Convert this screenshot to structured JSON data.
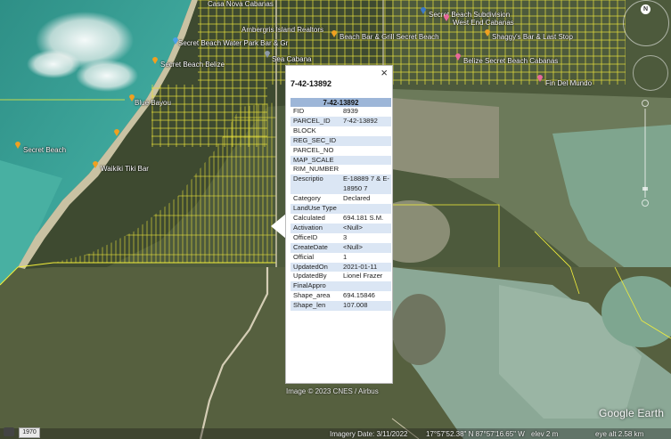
{
  "colors": {
    "parcel_lines": "#f4f03a",
    "popup_header": "#9db6d8",
    "popup_alt_row": "#dbe6f4",
    "pin_orange": "#f0a020",
    "pin_pink": "#e8689a"
  },
  "map_labels": [
    {
      "name": "Casa Nova Cabanas",
      "icon": "orange-pin-icon"
    },
    {
      "name": "Ambergris Island Realtors",
      "icon": "orange-pin-icon"
    },
    {
      "name": "Secret Beach Subdivision",
      "icon": "blue-pin-icon"
    },
    {
      "name": "West End Cabanas",
      "icon": "pink-pin-icon"
    },
    {
      "name": "Secret Beach Water Park Bar & Gr",
      "icon": "blue-pin-icon"
    },
    {
      "name": "Beach Bar & Grill Secret Beach",
      "icon": "orange-pin-icon"
    },
    {
      "name": "Shaggy's Bar & Last Stop",
      "icon": "orange-pin-icon"
    },
    {
      "name": "Sea Cabana",
      "icon": "gray-pin-icon"
    },
    {
      "name": "Secret Beach Belize",
      "icon": "orange-pin-icon"
    },
    {
      "name": "Belize Secret Beach Cabanas",
      "icon": "pink-pin-icon"
    },
    {
      "name": "Fin Del Mundo",
      "icon": "pink-pin-icon"
    },
    {
      "name": "Blue Bayou",
      "icon": "orange-pin-icon"
    },
    {
      "name": "Secret Beach",
      "icon": "orange-pin-icon"
    },
    {
      "name": "Waikiki Tiki Bar",
      "icon": "orange-pin-icon"
    }
  ],
  "popup": {
    "close_label": "×",
    "title": "7-42-13892",
    "table_header": "7-42-13892",
    "rows": [
      {
        "key": "FID",
        "value": "8939"
      },
      {
        "key": "PARCEL_ID",
        "value": "7-42-13892"
      },
      {
        "key": "BLOCK",
        "value": ""
      },
      {
        "key": "REG_SEC_ID",
        "value": ""
      },
      {
        "key": "PARCEL_NO",
        "value": ""
      },
      {
        "key": "MAP_SCALE",
        "value": ""
      },
      {
        "key": "RIM_NUMBER",
        "value": ""
      },
      {
        "key": "Descriptio",
        "value": "E-18889 7 & E-18950 7"
      },
      {
        "key": "Category",
        "value": "Declared"
      },
      {
        "key": "LandUse Type",
        "value": ""
      },
      {
        "key": "Calculated",
        "value": "694.181 S.M."
      },
      {
        "key": "Activation",
        "value": "<Null>"
      },
      {
        "key": "OfficeID",
        "value": "3"
      },
      {
        "key": "CreateDate",
        "value": "<Null>"
      },
      {
        "key": "Official",
        "value": "1"
      },
      {
        "key": "UpdatedOn",
        "value": "2021-01-11"
      },
      {
        "key": "UpdatedBy",
        "value": "Lionel Frazer"
      },
      {
        "key": "FinalAppro",
        "value": ""
      },
      {
        "key": "Shape_area",
        "value": "694.15846"
      },
      {
        "key": "Shape_len",
        "value": "107.008"
      }
    ]
  },
  "credit": "Image © 2023 CNES / Airbus",
  "status": {
    "year": "1970",
    "imagery_date": "Imagery Date: 3/11/2022",
    "coords": "17°57'52.38\" N    87°57'16.65\" W",
    "elev": "elev    2 m",
    "eye_alt": "eye alt    2.58 km"
  },
  "logo": "Google Earth",
  "compass_label": "N"
}
